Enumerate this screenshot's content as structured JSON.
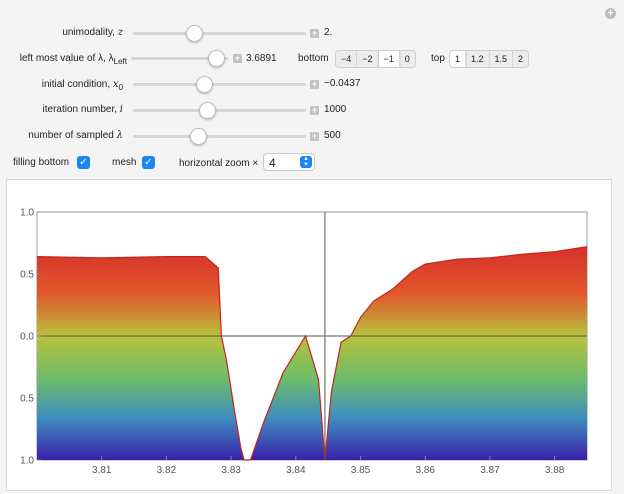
{
  "controls": {
    "unimodality": {
      "label_main": "unimodality, ",
      "label_var": "z",
      "value": "2.",
      "position": 0.28
    },
    "left_lambda": {
      "label_main": "left most value of λ, λ",
      "label_sub": "Left",
      "value": "3.6891",
      "position": 0.85
    },
    "initial": {
      "label_main": "initial condition, ",
      "label_var": "x",
      "label_sub": "0",
      "value": "−0.0437",
      "position": 0.36
    },
    "iteration": {
      "label_main": "iteration number, ",
      "label_var": "i",
      "value": "1000",
      "position": 0.37
    },
    "sampled": {
      "label_main": "number of sampled ",
      "label_var": "λ",
      "value": "500",
      "position": 0.34
    }
  },
  "bottom": {
    "label": "bottom",
    "options": [
      "−4",
      "−2",
      "−1",
      "0"
    ],
    "selected": "−1"
  },
  "top": {
    "label": "top",
    "options": [
      "1",
      "1.2",
      "1.5",
      "2"
    ],
    "selected": "1"
  },
  "filling_bottom": {
    "label": "filling bottom",
    "checked": true
  },
  "mesh": {
    "label": "mesh",
    "checked": true
  },
  "zoom": {
    "label": "horizontal zoom ×",
    "value": "4"
  },
  "reset_icon": "plus-circle-icon",
  "chart_data": {
    "type": "area",
    "x_ticks": [
      "3.81",
      "3.82",
      "3.83",
      "3.84",
      "3.85",
      "3.86",
      "3.87",
      "3.88"
    ],
    "y_ticks": [
      "1.0",
      "0.5",
      "0.0",
      "0.5",
      "1.0"
    ],
    "xlim": [
      3.8,
      3.885
    ],
    "ylim": [
      -1.0,
      1.0
    ],
    "crosshair_x": 3.8445,
    "crosshair_y": 0.0,
    "upper_envelope": [
      [
        3.8,
        0.64
      ],
      [
        3.81,
        0.63
      ],
      [
        3.82,
        0.64
      ],
      [
        3.826,
        0.64
      ],
      [
        3.828,
        0.55
      ],
      [
        3.8285,
        0.0
      ],
      [
        3.8293,
        -0.2
      ],
      [
        3.8305,
        -0.6
      ],
      [
        3.8315,
        -0.9
      ],
      [
        3.832,
        -1.0
      ],
      [
        3.833,
        -1.0
      ],
      [
        3.835,
        -0.7
      ],
      [
        3.838,
        -0.3
      ],
      [
        3.8415,
        0.0
      ],
      [
        3.8435,
        -0.35
      ],
      [
        3.8445,
        -1.0
      ],
      [
        3.8455,
        -0.45
      ],
      [
        3.847,
        -0.05
      ],
      [
        3.8485,
        0.0
      ],
      [
        3.85,
        0.15
      ],
      [
        3.852,
        0.28
      ],
      [
        3.855,
        0.38
      ],
      [
        3.858,
        0.52
      ],
      [
        3.86,
        0.58
      ],
      [
        3.865,
        0.62
      ],
      [
        3.87,
        0.63
      ],
      [
        3.875,
        0.66
      ],
      [
        3.88,
        0.68
      ],
      [
        3.885,
        0.72
      ]
    ],
    "fill_bottom": -1.0,
    "colormap": "rainbow"
  }
}
